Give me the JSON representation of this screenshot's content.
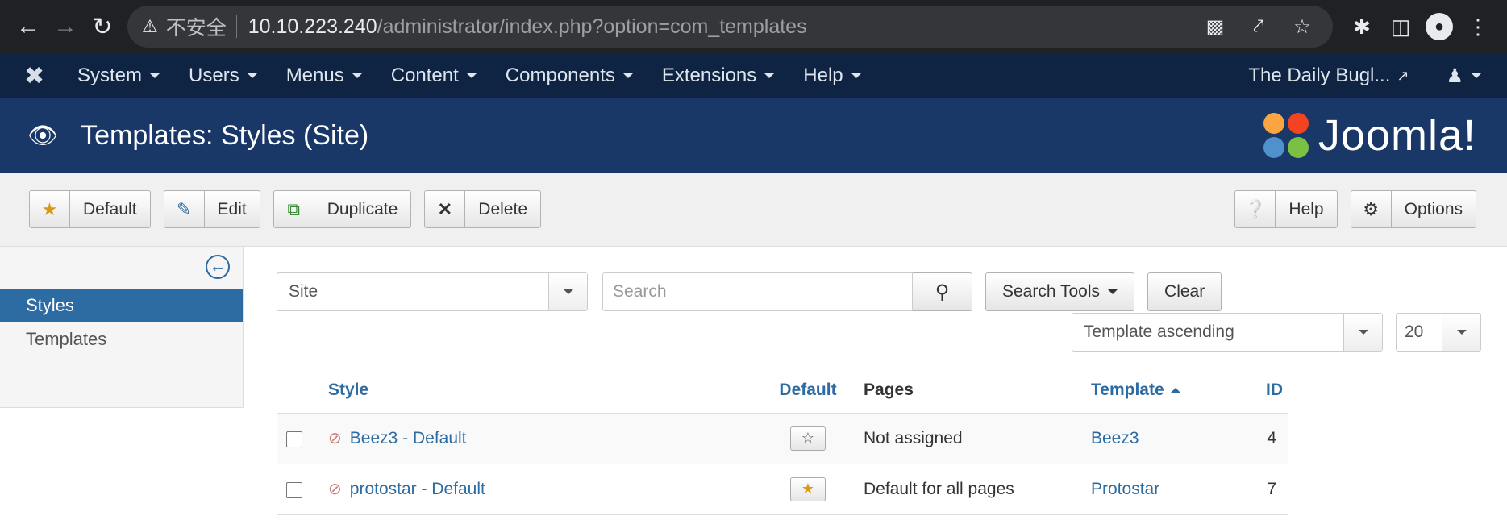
{
  "browser": {
    "security_label": "不安全",
    "url_host": "10.10.223.240",
    "url_path": "/administrator/index.php?option=com_templates"
  },
  "topnav": {
    "menus": [
      "System",
      "Users",
      "Menus",
      "Content",
      "Components",
      "Extensions",
      "Help"
    ],
    "site_link": "The Daily Bugl..."
  },
  "header": {
    "title": "Templates: Styles (Site)",
    "brand": "Joomla!"
  },
  "toolbar": {
    "default_label": "Default",
    "edit_label": "Edit",
    "duplicate_label": "Duplicate",
    "delete_label": "Delete",
    "help_label": "Help",
    "options_label": "Options"
  },
  "sidebar": {
    "items": [
      {
        "label": "Styles",
        "active": true
      },
      {
        "label": "Templates",
        "active": false
      }
    ]
  },
  "filters": {
    "client_value": "Site",
    "search_placeholder": "Search",
    "search_tools_label": "Search Tools",
    "clear_label": "Clear",
    "ordering_value": "Template ascending",
    "limit_value": "20"
  },
  "table": {
    "headers": {
      "style": "Style",
      "default": "Default",
      "pages": "Pages",
      "template": "Template",
      "id": "ID"
    },
    "rows": [
      {
        "style": "Beez3 - Default",
        "is_default": false,
        "pages": "Not assigned",
        "template": "Beez3",
        "id": "4"
      },
      {
        "style": "protostar - Default",
        "is_default": true,
        "pages": "Default for all pages",
        "template": "Protostar",
        "id": "7"
      }
    ]
  }
}
